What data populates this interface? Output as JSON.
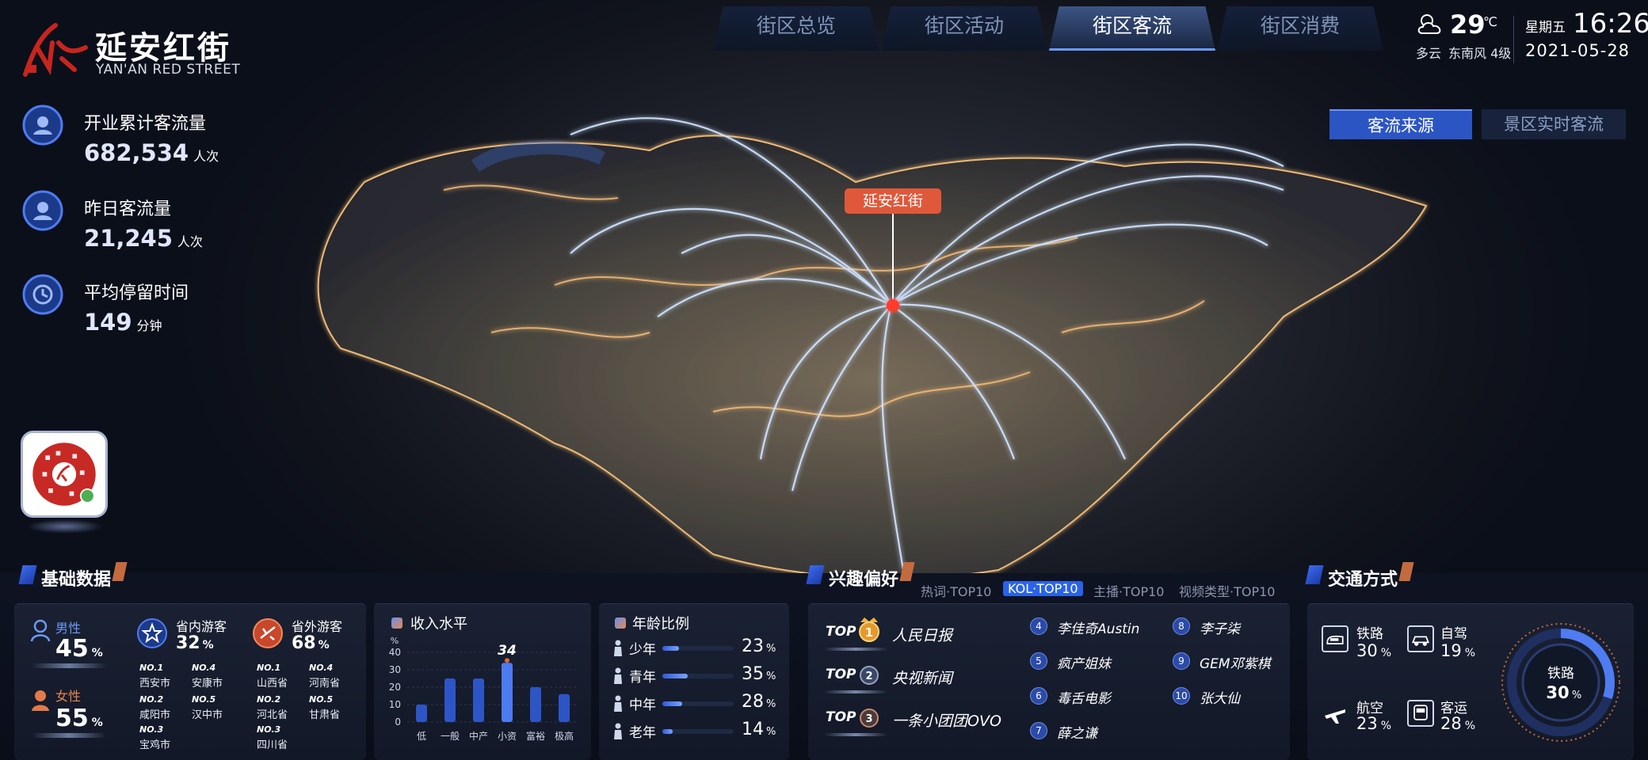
{
  "brand": {
    "name_cn": "延安红街",
    "name_en": "YAN'AN RED STREET"
  },
  "nav": {
    "tabs": [
      "街区总览",
      "街区活动",
      "街区客流",
      "街区消费"
    ],
    "active": 2
  },
  "weather": {
    "temp": "29",
    "unit": "℃",
    "condition": "多云",
    "wind": "东南风 4级"
  },
  "clock": {
    "weekday": "星期五",
    "time": "16:26",
    "date": "2021-05-28"
  },
  "stats": [
    {
      "label": "开业累计客流量",
      "value": "682,534",
      "unit": "人次"
    },
    {
      "label": "昨日客流量",
      "value": "21,245",
      "unit": "人次"
    },
    {
      "label": "平均停留时间",
      "value": "149",
      "unit": "分钟"
    }
  ],
  "map": {
    "marker": "延安红街",
    "buttons": [
      "客流来源",
      "景区实时客流"
    ]
  },
  "basic": {
    "title": "基础数据",
    "gender": [
      {
        "label": "男性",
        "value": "45",
        "unit": "%"
      },
      {
        "label": "女性",
        "value": "55",
        "unit": "%"
      }
    ],
    "in_province": {
      "label": "省内游客",
      "value": "32",
      "unit": "%",
      "ranks": [
        [
          "NO.1",
          "西安市"
        ],
        [
          "NO.4",
          "安康市"
        ],
        [
          "NO.2",
          "咸阳市"
        ],
        [
          "NO.5",
          "汉中市"
        ],
        [
          "NO.3",
          "宝鸡市"
        ]
      ]
    },
    "out_province": {
      "label": "省外游客",
      "value": "68",
      "unit": "%",
      "ranks": [
        [
          "NO.1",
          "山西省"
        ],
        [
          "NO.4",
          "河南省"
        ],
        [
          "NO.2",
          "河北省"
        ],
        [
          "NO.5",
          "甘肃省"
        ],
        [
          "NO.3",
          "四川省"
        ]
      ]
    }
  },
  "chart_data": {
    "type": "bar",
    "title": "收入水平",
    "ylabel": "%",
    "categories": [
      "低",
      "一般",
      "中产",
      "小资",
      "富裕",
      "极高"
    ],
    "values": [
      10,
      25,
      25,
      34,
      20,
      16
    ],
    "yticks": [
      "0",
      "10",
      "20",
      "30",
      "40"
    ],
    "ylim": [
      0,
      40
    ],
    "highlight": "34",
    "grid": true
  },
  "age": {
    "title": "年龄比例",
    "rows": [
      {
        "label": "少年",
        "value": "23",
        "pct": 23
      },
      {
        "label": "青年",
        "value": "35",
        "pct": 35
      },
      {
        "label": "中年",
        "value": "28",
        "pct": 28
      },
      {
        "label": "老年",
        "value": "14",
        "pct": 14
      }
    ],
    "unit": "%"
  },
  "interest": {
    "title": "兴趣偏好",
    "filters": [
      "热词·TOP10",
      "KOL·TOP10",
      "主播·TOP10",
      "视频类型·TOP10"
    ],
    "active": 1,
    "top_label": "TOP",
    "top": [
      {
        "rank": "1",
        "name": "人民日报"
      },
      {
        "rank": "2",
        "name": "央视新闻"
      },
      {
        "rank": "3",
        "name": "一条小团团OVO"
      }
    ],
    "others": [
      {
        "rank": "4",
        "name": "李佳奇Austin"
      },
      {
        "rank": "5",
        "name": "疯产姐妹"
      },
      {
        "rank": "6",
        "name": "毒舌电影"
      },
      {
        "rank": "7",
        "name": "薛之谦"
      },
      {
        "rank": "8",
        "name": "李子柒"
      },
      {
        "rank": "9",
        "name": "GEM邓紫棋"
      },
      {
        "rank": "10",
        "name": "张大仙"
      }
    ]
  },
  "transport": {
    "title": "交通方式",
    "items": [
      {
        "label": "铁路",
        "value": "30",
        "unit": "%"
      },
      {
        "label": "自驾",
        "value": "19",
        "unit": "%"
      },
      {
        "label": "航空",
        "value": "23",
        "unit": "%"
      },
      {
        "label": "客运",
        "value": "28",
        "unit": "%"
      }
    ],
    "ring": {
      "label": "铁路",
      "value": "30",
      "unit": "%",
      "pct": 30
    },
    "colors": {
      "ring": "#4f7cf0",
      "accent": "#2a63e8"
    }
  }
}
